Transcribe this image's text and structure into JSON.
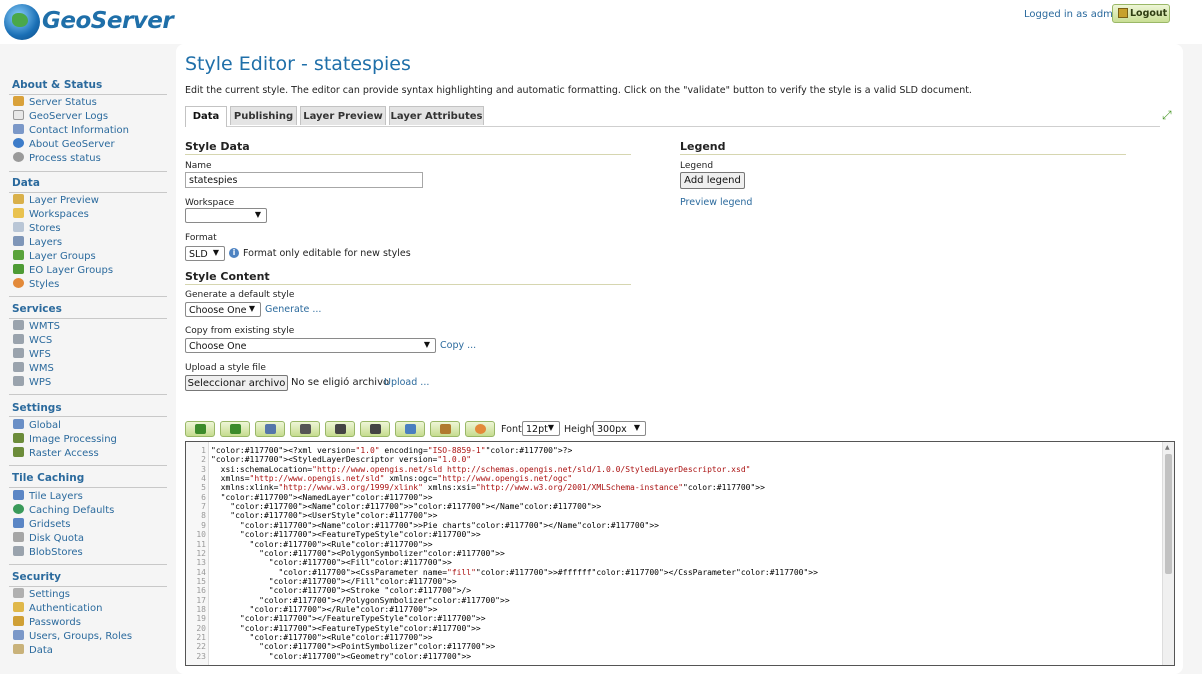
{
  "header": {
    "logo_text": "GeoServer",
    "logged_in": "Logged in as admin.",
    "logout_label": "Logout"
  },
  "sidebar": {
    "sections": [
      {
        "title": "About & Status",
        "items": [
          "Server Status",
          "GeoServer Logs",
          "Contact Information",
          "About GeoServer",
          "Process status"
        ]
      },
      {
        "title": "Data",
        "items": [
          "Layer Preview",
          "Workspaces",
          "Stores",
          "Layers",
          "Layer Groups",
          "EO Layer Groups",
          "Styles"
        ]
      },
      {
        "title": "Services",
        "items": [
          "WMTS",
          "WCS",
          "WFS",
          "WMS",
          "WPS"
        ]
      },
      {
        "title": "Settings",
        "items": [
          "Global",
          "Image Processing",
          "Raster Access"
        ]
      },
      {
        "title": "Tile Caching",
        "items": [
          "Tile Layers",
          "Caching Defaults",
          "Gridsets",
          "Disk Quota",
          "BlobStores"
        ]
      },
      {
        "title": "Security",
        "items": [
          "Settings",
          "Authentication",
          "Passwords",
          "Users, Groups, Roles",
          "Data"
        ]
      }
    ]
  },
  "main": {
    "title": "Style Editor - statespies",
    "description": "Edit the current style. The editor can provide syntax highlighting and automatic formatting. Click on the \"validate\" button to verify the style is a valid SLD document.",
    "tabs": [
      "Data",
      "Publishing",
      "Layer Preview",
      "Layer Attributes"
    ],
    "style_data": {
      "heading": "Style Data",
      "name_label": "Name",
      "name_value": "statespies",
      "workspace_label": "Workspace",
      "workspace_value": "",
      "format_label": "Format",
      "format_value": "SLD",
      "format_note": "Format only editable for new styles"
    },
    "legend": {
      "heading": "Legend",
      "label": "Legend",
      "add_button": "Add legend",
      "preview_link": "Preview legend"
    },
    "style_content": {
      "heading": "Style Content",
      "generate_label": "Generate a default style",
      "generate_select": "Choose One",
      "generate_link": "Generate ...",
      "copy_label": "Copy from existing style",
      "copy_select": "Choose One",
      "copy_link": "Copy ...",
      "upload_label": "Upload a style file",
      "upload_button": "Seleccionar archivo",
      "upload_status": "No se eligió archivo",
      "upload_link": "Upload ..."
    },
    "toolbar": {
      "font_label": "Font",
      "font_value": "12pt",
      "height_label": "Height",
      "height_value": "300px",
      "button_icons": [
        "redo-icon",
        "undo-icon",
        "search-replace-icon",
        "go-to-line-icon",
        "indent-icon",
        "format-icon",
        "zoom-icon",
        "image-icon",
        "palette-icon"
      ]
    },
    "code_lines": [
      "<?xml version=\"1.0\" encoding=\"ISO-8859-1\"?>",
      "<StyledLayerDescriptor version=\"1.0.0\"",
      "  xsi:schemaLocation=\"http://www.opengis.net/sld http://schemas.opengis.net/sld/1.0.0/StyledLayerDescriptor.xsd\"",
      "  xmlns=\"http://www.opengis.net/sld\" xmlns:ogc=\"http://www.opengis.net/ogc\"",
      "  xmlns:xlink=\"http://www.w3.org/1999/xlink\" xmlns:xsi=\"http://www.w3.org/2001/XMLSchema-instance\">",
      "  <NamedLayer>",
      "    <Name></Name>",
      "    <UserStyle>",
      "      <Name>Pie charts</Name>",
      "      <FeatureTypeStyle>",
      "        <Rule>",
      "          <PolygonSymbolizer>",
      "            <Fill>",
      "              <CssParameter name=\"fill\">#ffffff</CssParameter>",
      "            </Fill>",
      "            <Stroke />",
      "          </PolygonSymbolizer>",
      "        </Rule>",
      "      </FeatureTypeStyle>",
      "      <FeatureTypeStyle>",
      "        <Rule>",
      "          <PointSymbolizer>",
      "            <Geometry>"
    ]
  }
}
